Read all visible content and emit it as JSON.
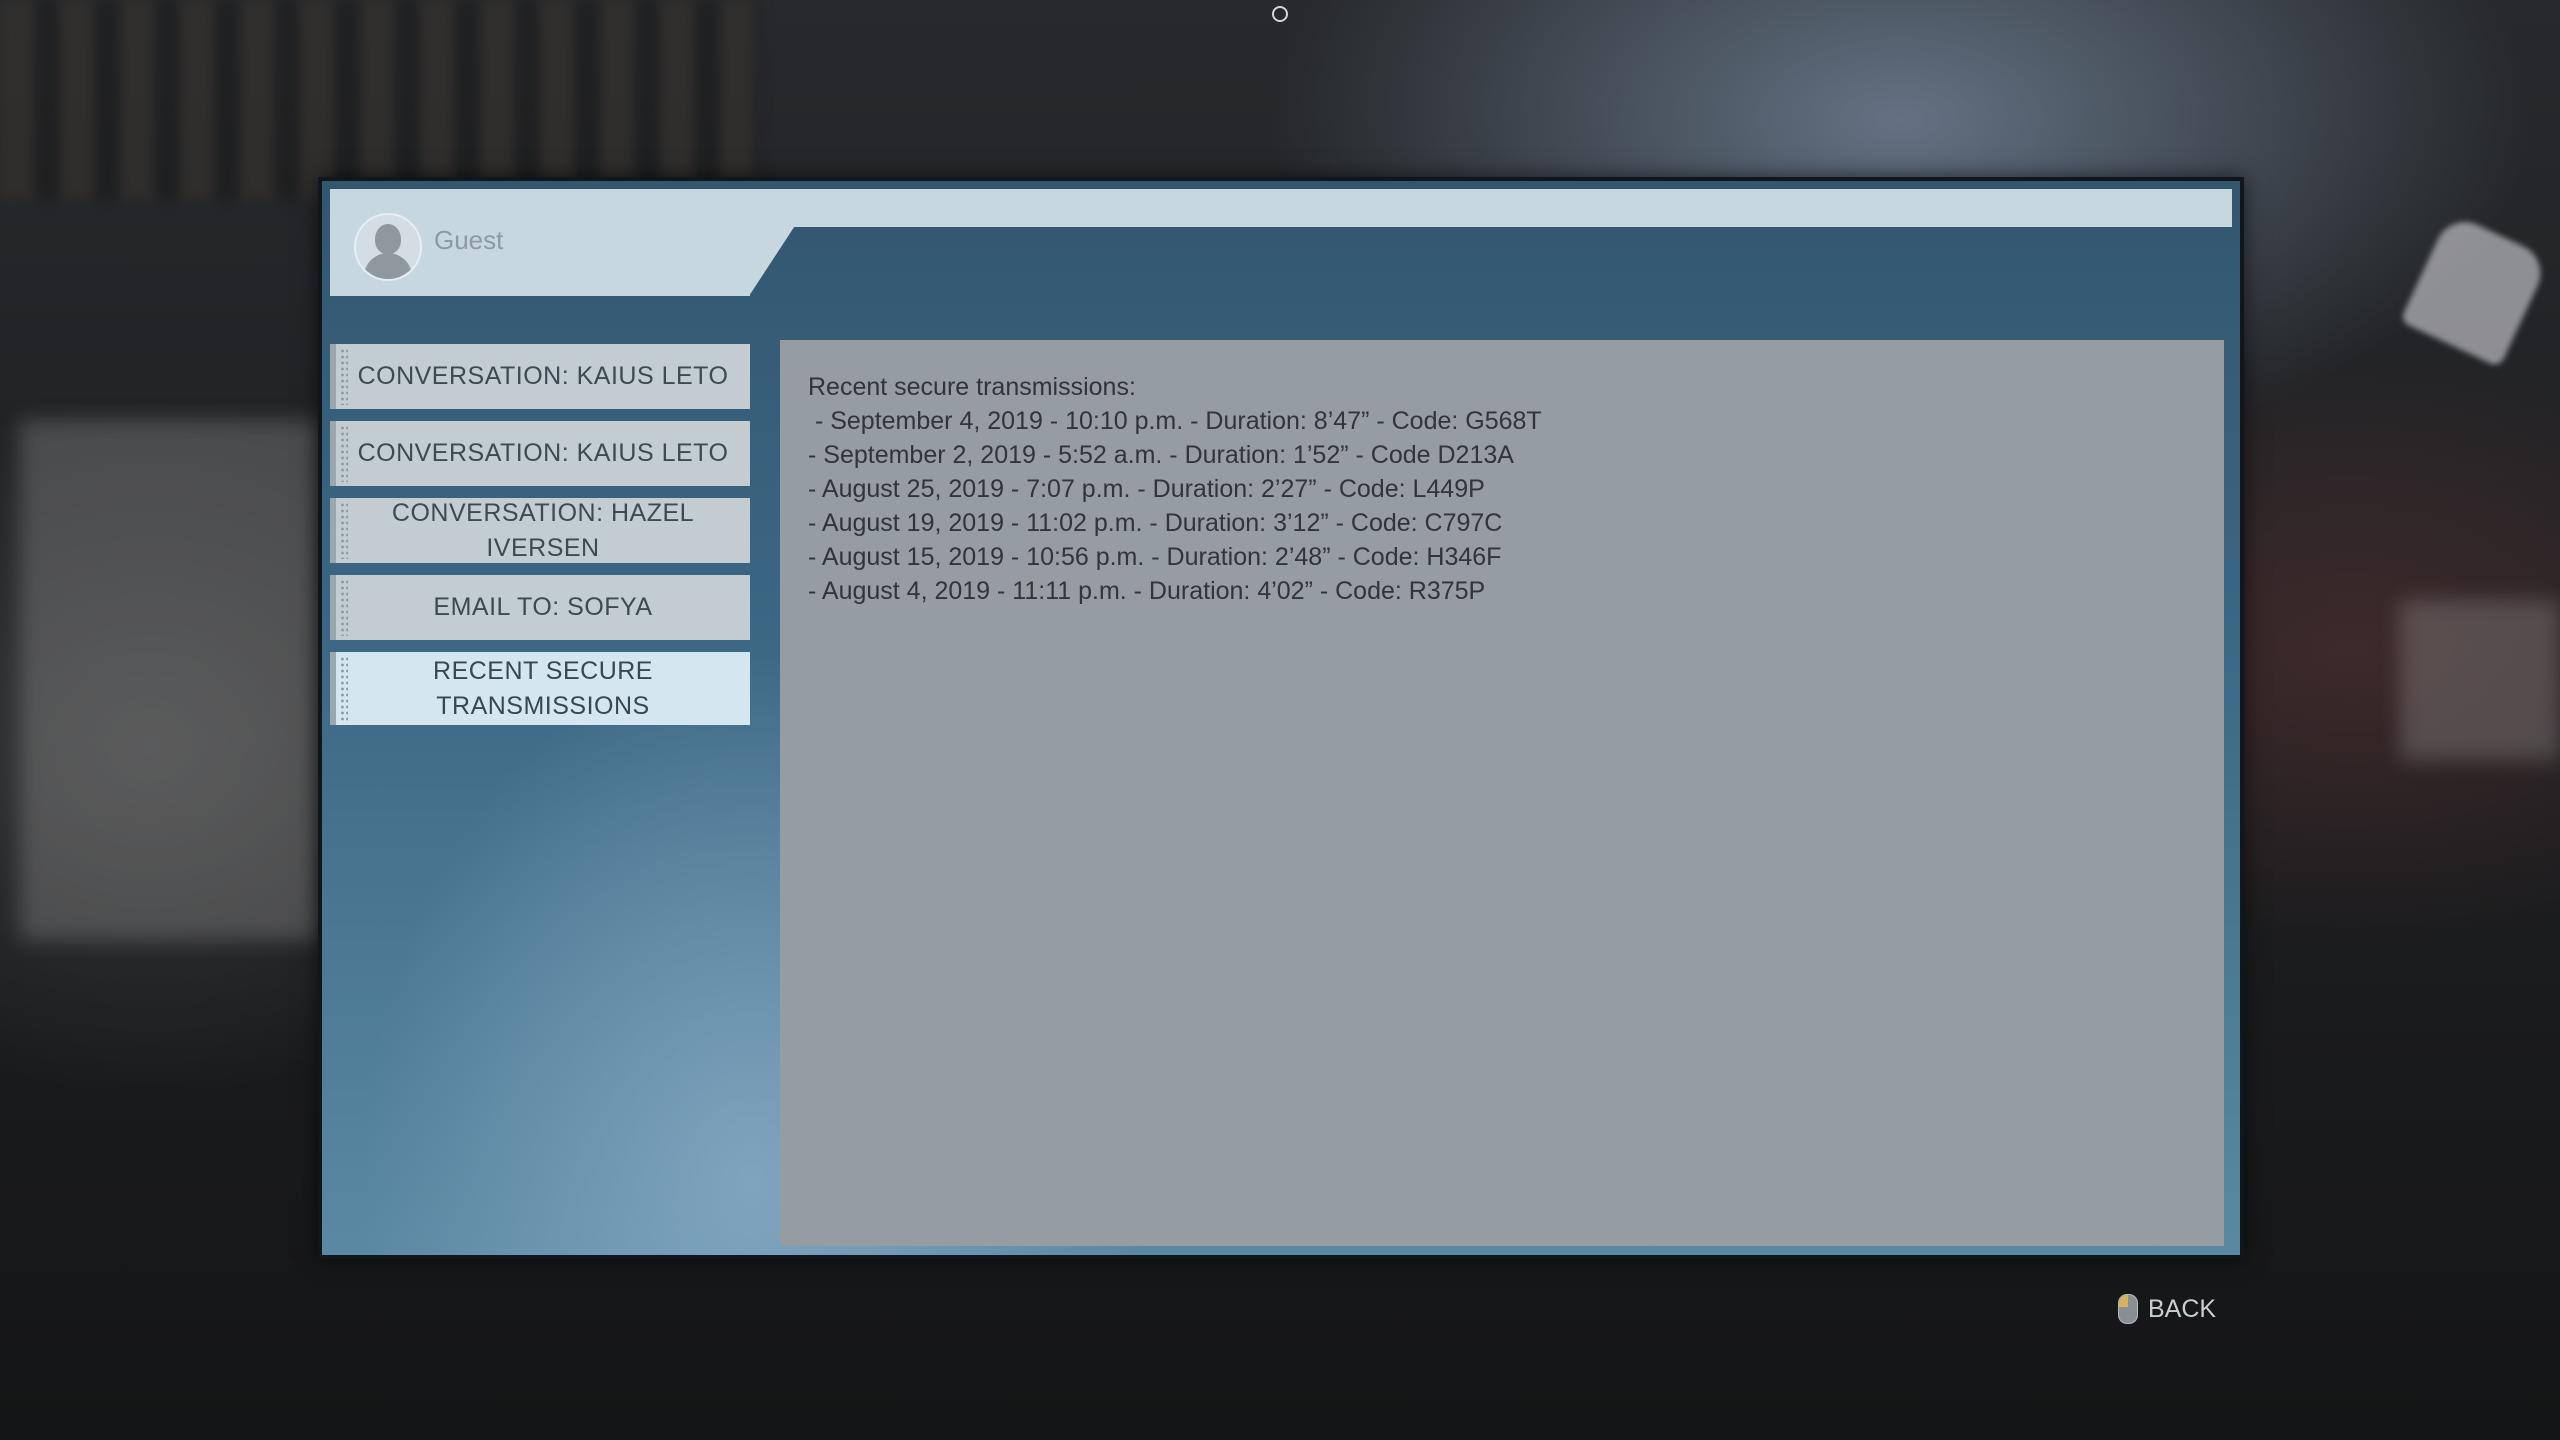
{
  "user": {
    "name": "Guest"
  },
  "sidebar": {
    "items": [
      {
        "label": "CONVERSATION: KAIUS LETO",
        "active": false
      },
      {
        "label": "CONVERSATION: KAIUS LETO",
        "active": false
      },
      {
        "label": "CONVERSATION: HAZEL IVERSEN",
        "active": false
      },
      {
        "label": "EMAIL TO: SOFYA",
        "active": false
      },
      {
        "label": "RECENT SECURE TRANSMISSIONS",
        "active": true
      }
    ]
  },
  "content": {
    "heading": "Recent secure transmissions:",
    "lines": [
      " - September 4, 2019 - 10:10 p.m. - Duration: 8’47” - Code: G568T",
      "- September 2, 2019 - 5:52 a.m. - Duration: 1’52” - Code D213A",
      "- August 25, 2019 - 7:07 p.m. - Duration: 2’27” - Code: L449P",
      "- August 19, 2019 - 11:02 p.m. - Duration: 3’12” - Code: C797C",
      "- August 15, 2019 - 10:56 p.m. - Duration: 2’48” - Code: H346F",
      "- August 4, 2019 - 11:11 p.m. - Duration: 4’02” - Code: R375P"
    ]
  },
  "footer": {
    "back_label": "BACK",
    "back_icon": "mouse-icon"
  },
  "colors": {
    "panel": "#3b6683",
    "header": "#c7d7e0",
    "content_bg": "#959ca2",
    "menu_item": "#c3ccd1",
    "menu_item_active": "#d4e7f1"
  }
}
